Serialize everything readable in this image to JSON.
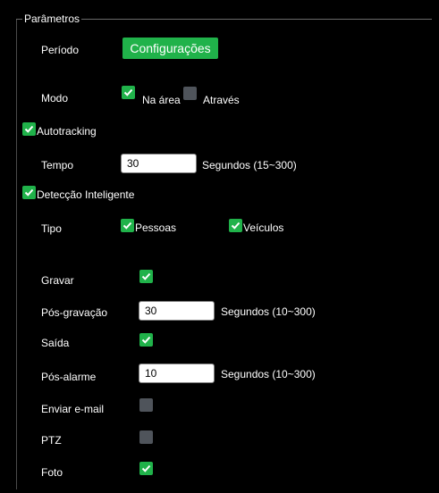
{
  "fieldset": {
    "legend": "Parâmetros"
  },
  "periodo": {
    "label": "Período",
    "button": "Configurações"
  },
  "modo": {
    "label": "Modo",
    "options": [
      {
        "label": "Na área",
        "checked": true
      },
      {
        "label": "Através",
        "checked": false
      }
    ]
  },
  "autotracking": {
    "label": "Autotracking",
    "checked": true
  },
  "tempo": {
    "label": "Tempo",
    "value": "30",
    "unit": "Segundos (15~300)"
  },
  "deteccao": {
    "label": "Detecção Inteligente",
    "checked": true
  },
  "tipo": {
    "label": "Tipo",
    "options": [
      {
        "label": "Pessoas",
        "checked": true
      },
      {
        "label": "Veículos",
        "checked": true
      }
    ]
  },
  "gravar": {
    "label": "Gravar",
    "checked": true
  },
  "pos_gravacao": {
    "label": "Pós-gravação",
    "value": "30",
    "unit": "Segundos (10~300)"
  },
  "saida": {
    "label": "Saída",
    "checked": true
  },
  "pos_alarme": {
    "label": "Pós-alarme",
    "value": "10",
    "unit": "Segundos (10~300)"
  },
  "enviar_email": {
    "label": "Enviar e-mail",
    "checked": false
  },
  "ptz": {
    "label": "PTZ",
    "checked": false
  },
  "foto": {
    "label": "Foto",
    "checked": true
  },
  "colors": {
    "accent": "#20b24a",
    "unchecked": "#4f545b",
    "background": "#000000"
  }
}
